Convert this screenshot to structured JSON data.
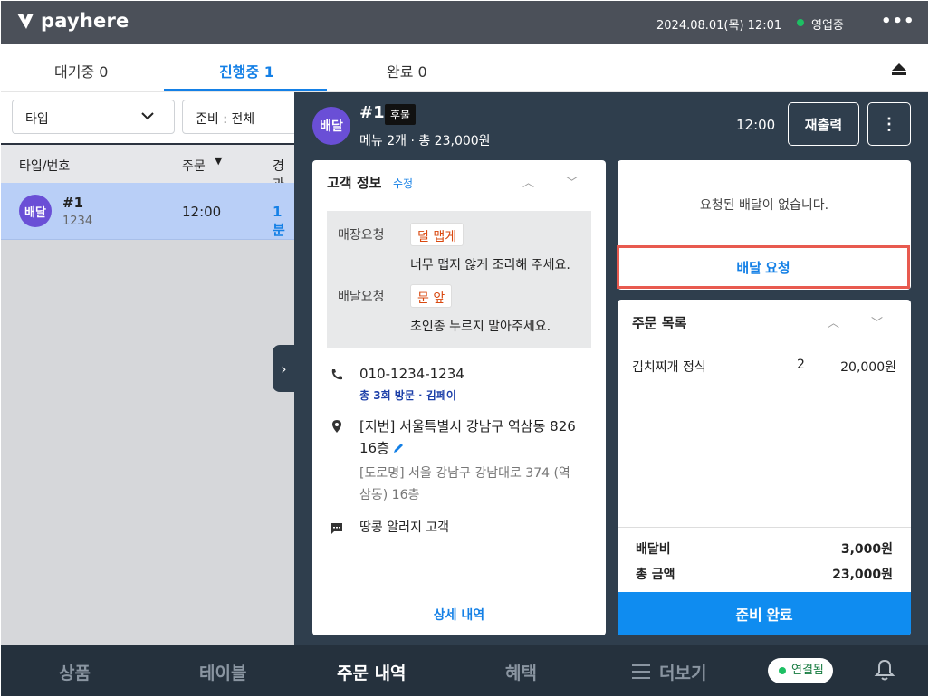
{
  "brand": {
    "name": "payhere"
  },
  "topbar": {
    "datetime": "2024.08.01(목) 12:01",
    "status": "영업중",
    "more_icon": "more-horizontal-icon"
  },
  "tabs": [
    {
      "label": "대기중 0"
    },
    {
      "label": "진행중 1"
    },
    {
      "label": "완료 0"
    }
  ],
  "filters": {
    "type_label": "타입",
    "prep_label": "준비 : 전체"
  },
  "list": {
    "headers": {
      "type_no": "타입/번호",
      "order": "주문",
      "elapsed": "경과"
    },
    "rows": [
      {
        "badge": "배달",
        "no": "#1",
        "sub": "1234",
        "time": "12:00",
        "elapsed": "1분"
      }
    ]
  },
  "detail": {
    "badge": "배달",
    "title": "#1",
    "pay_badge": "후불",
    "summary": "메뉴 2개 · 총 23,000원",
    "time": "12:00",
    "reprint_label": "재출력",
    "kebab": "⋮"
  },
  "customer": {
    "title": "고객 정보",
    "edit": "수정",
    "store_req_label": "매장요청",
    "store_req_tag": "덜 맵게",
    "store_req_text": "너무 맵지 않게 조리해 주세요.",
    "delivery_req_label": "배달요청",
    "delivery_req_tag": "문 앞",
    "delivery_req_text": "초인종 누르지 말아주세요.",
    "phone": "010-1234-1234",
    "visits": "총 3회 방문 · 김페이",
    "address_line1": "[지번] 서울특별시 강남구 역삼동 826",
    "address_line2": "16층",
    "road_line1": "[도로명] 서울 강남구 강남대로 374 (역",
    "road_line2": "삼동) 16층",
    "memo": "땅콩 알러지 고객",
    "details_link": "상세 내역"
  },
  "delivery": {
    "empty_text": "요청된 배달이 없습니다.",
    "request_button": "배달 요청"
  },
  "orders": {
    "title": "주문 목록",
    "items": [
      {
        "name": "김치찌개 정식",
        "qty": "2",
        "price": "20,000원"
      }
    ],
    "fee_label": "배달비",
    "fee_value": "3,000원",
    "total_label": "총 금액",
    "total_value": "23,000원",
    "ready_button": "준비 완료"
  },
  "bottomnav": {
    "items": [
      {
        "label": "상품"
      },
      {
        "label": "테이블"
      },
      {
        "label": "주문 내역"
      },
      {
        "label": "혜택"
      },
      {
        "label": "더보기"
      }
    ],
    "connection": "연결됨"
  },
  "colors": {
    "accent": "#1480e6",
    "primary_button": "#0f8cf0",
    "highlight_border": "#e85a4f",
    "avatar": "#6a4fd6",
    "online": "#1dbf63"
  }
}
